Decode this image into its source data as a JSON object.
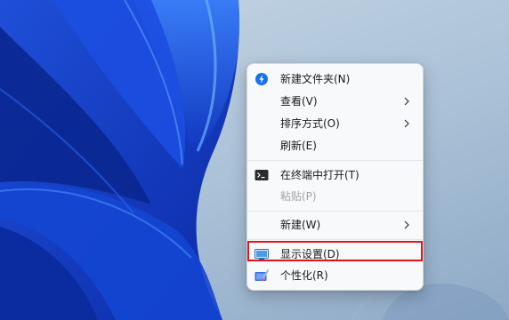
{
  "context_menu": {
    "items": [
      {
        "label": "新建文件夹(N)"
      },
      {
        "label": "查看(V)"
      },
      {
        "label": "排序方式(O)"
      },
      {
        "label": "刷新(E)"
      },
      {
        "label": "在终端中打开(T)"
      },
      {
        "label": "粘贴(P)"
      },
      {
        "label": "新建(W)"
      },
      {
        "label": "显示设置(D)"
      },
      {
        "label": "个性化(R)"
      }
    ]
  },
  "colors": {
    "highlight_border": "#e1131b",
    "menu_background": "#f7f9fb",
    "disabled_text": "#a3a3a3"
  },
  "icons": [
    "new-folder-icon",
    "terminal-icon",
    "display-icon",
    "personalize-icon",
    "chevron-right-icon"
  ]
}
